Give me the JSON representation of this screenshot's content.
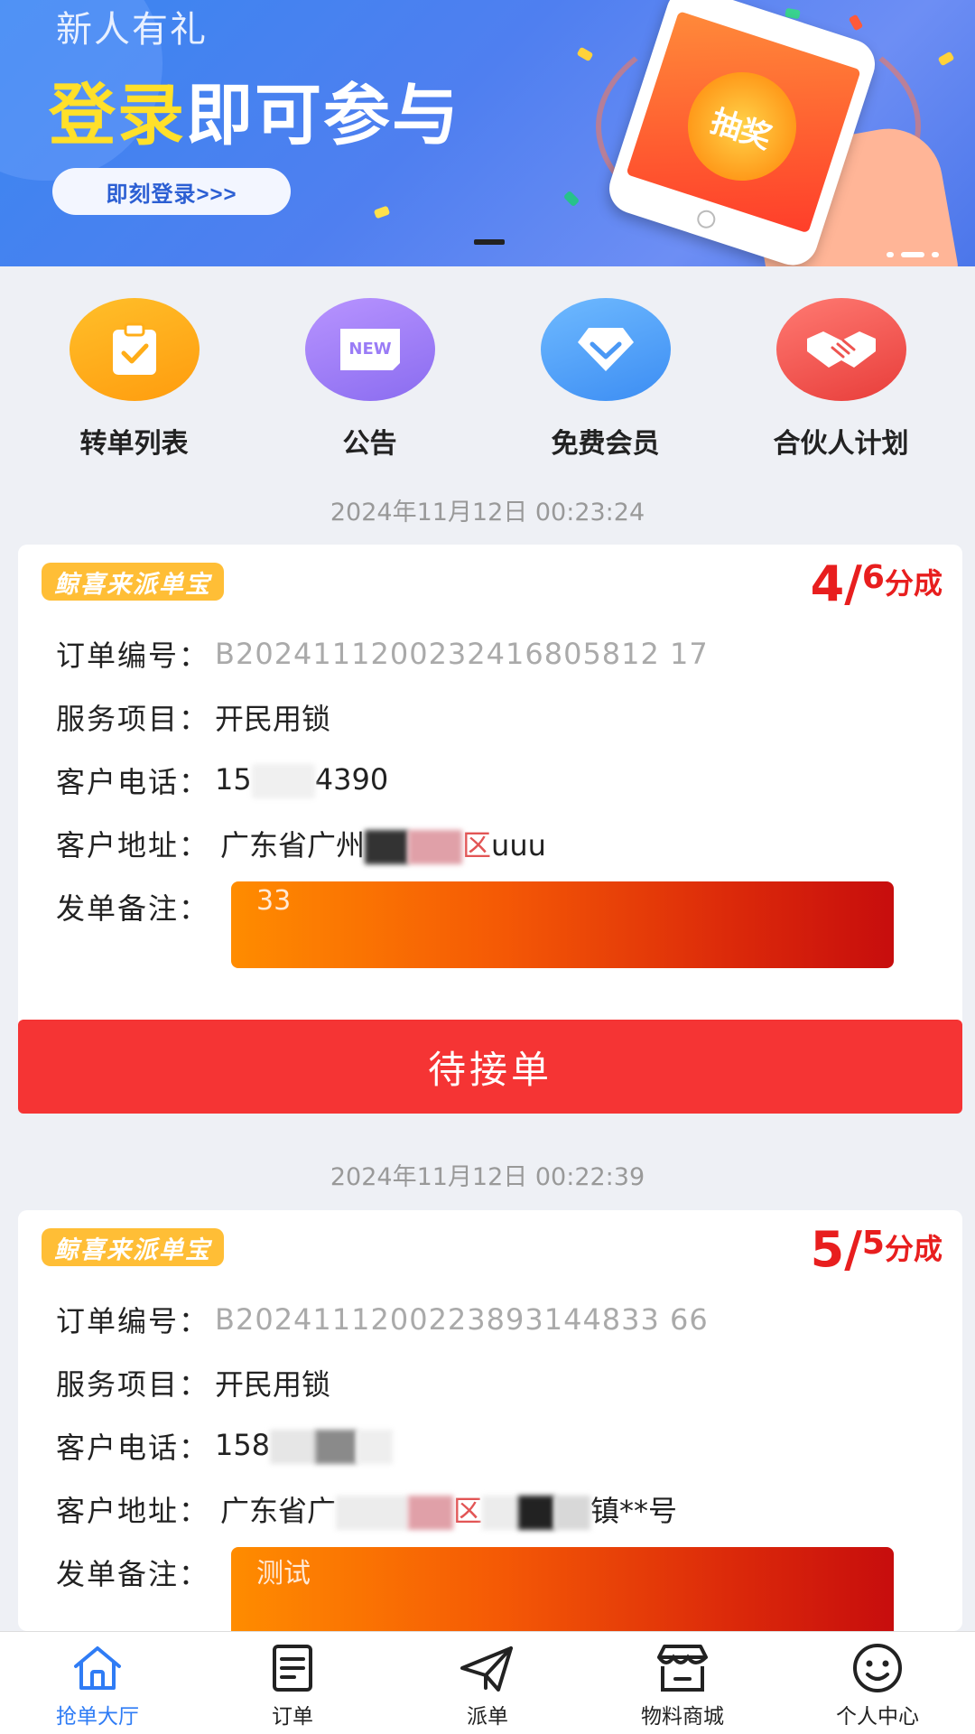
{
  "banner": {
    "subtitle": "新人有礼",
    "headline_highlight": "登录",
    "headline_rest": "即可参与",
    "login_button": "即刻登录>>>",
    "phone_text": "抽奖"
  },
  "menu": [
    {
      "label": "转单列表",
      "icon": "clipboard-check-icon"
    },
    {
      "label": "公告",
      "icon": "new-badge-icon",
      "icon_text": "NEW"
    },
    {
      "label": "免费会员",
      "icon": "diamond-icon"
    },
    {
      "label": "合伙人计划",
      "icon": "handshake-icon"
    }
  ],
  "orders": [
    {
      "timestamp": "2024年11月12日 00:23:24",
      "tag": "鲸喜来派单宝",
      "share_main": "4/",
      "share_sup": "6",
      "share_unit": "分成",
      "order_no_label": "订单编号：",
      "order_no": "B2024111200232416805812 17",
      "service_label": "服务项目：",
      "service": "开民用锁",
      "phone_label": "客户电话：",
      "phone_start": "15",
      "phone_end": "4390",
      "address_label": "客户地址：",
      "address_start": "广东省广州",
      "address_end": "区",
      "address_tail": "uuu",
      "remark_label": "发单备注：",
      "remark": "33",
      "button": "待接单"
    },
    {
      "timestamp": "2024年11月12日 00:22:39",
      "tag": "鲸喜来派单宝",
      "share_main": "5/",
      "share_sup": "5",
      "share_unit": "分成",
      "order_no_label": "订单编号：",
      "order_no": "B2024111200223893144833 66",
      "service_label": "服务项目：",
      "service": "开民用锁",
      "phone_label": "客户电话：",
      "phone_start": "158",
      "phone_end": "",
      "address_label": "客户地址：",
      "address_start": "广东省广",
      "address_end": "区",
      "address_tail": "镇**号",
      "remark_label": "发单备注：",
      "remark": "测试"
    }
  ],
  "tabbar": [
    {
      "label": "抢单大厅",
      "icon": "home-icon",
      "active": true
    },
    {
      "label": "订单",
      "icon": "order-list-icon",
      "active": false
    },
    {
      "label": "派单",
      "icon": "paper-plane-icon",
      "active": false
    },
    {
      "label": "物料商城",
      "icon": "store-icon",
      "active": false
    },
    {
      "label": "个人中心",
      "icon": "smiley-face-icon",
      "active": false
    }
  ],
  "colors": {
    "accent_blue": "#2f7cf5",
    "accept_red": "#f53434",
    "share_red": "#e81e1e",
    "tag_yellow": "#ffbe36"
  }
}
